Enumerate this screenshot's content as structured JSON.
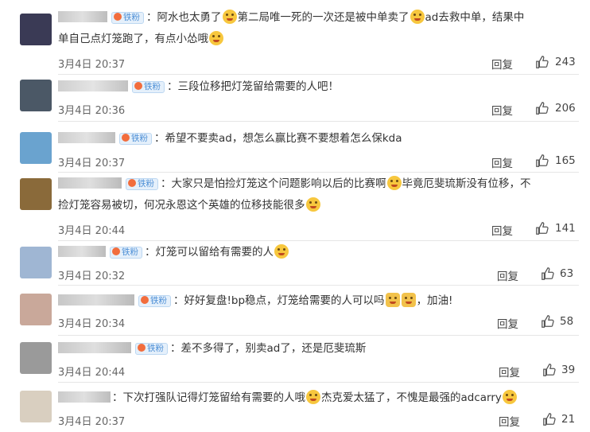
{
  "comments": [
    {
      "badge": "铁粉",
      "text_line1": "：阿水也太勇了",
      "text_mid1": "第二局唯一死的一次还是被中单卖了",
      "text_mid2": "ad去救中单，结果中",
      "text_line2": "单自己点灯笼跑了，有点小怂哦",
      "time": "3月4日 20:37",
      "reply": "回复",
      "likes": "243"
    },
    {
      "badge": "铁粉",
      "text_line1": "：三段位移把灯笼留给需要的人吧！",
      "time": "3月4日 20:36",
      "reply": "回复",
      "likes": "206"
    },
    {
      "badge": "铁粉",
      "text_line1": "：希望不要卖ad，想怎么赢比赛不要想着怎么保kda",
      "time": "3月4日 20:37",
      "reply": "回复",
      "likes": "165"
    },
    {
      "badge": "铁粉",
      "text_line1": "：大家只是怕捡灯笼这个问题影响以后的比赛啊",
      "text_mid1": "毕竟厄斐琉斯没有位移，不",
      "text_line2": "捡灯笼容易被切，何况永恩这个英雄的位移技能很多",
      "time": "3月4日 20:44",
      "reply": "回复",
      "likes": "141"
    },
    {
      "badge": "铁粉",
      "text_line1": "：灯笼可以留给有需要的人",
      "time": "3月4日 20:32",
      "reply": "回复",
      "likes": "63"
    },
    {
      "badge": "铁粉",
      "text_line1": "：好好复盘!bp稳点，灯笼给需要的人可以吗",
      "text_mid1": "，加油!",
      "time": "3月4日 20:34",
      "reply": "回复",
      "likes": "58"
    },
    {
      "badge": "铁粉",
      "text_line1": "：差不多得了，别卖ad了，还是厄斐琉斯",
      "time": "3月4日 20:44",
      "reply": "回复",
      "likes": "39"
    },
    {
      "text_line1": "：下次打强队记得灯笼留给有需要的人哦",
      "text_mid1": "杰克爱太猛了，不愧是最强的adcarry",
      "time": "3月4日 20:37",
      "reply": "回复",
      "likes": "21"
    }
  ]
}
